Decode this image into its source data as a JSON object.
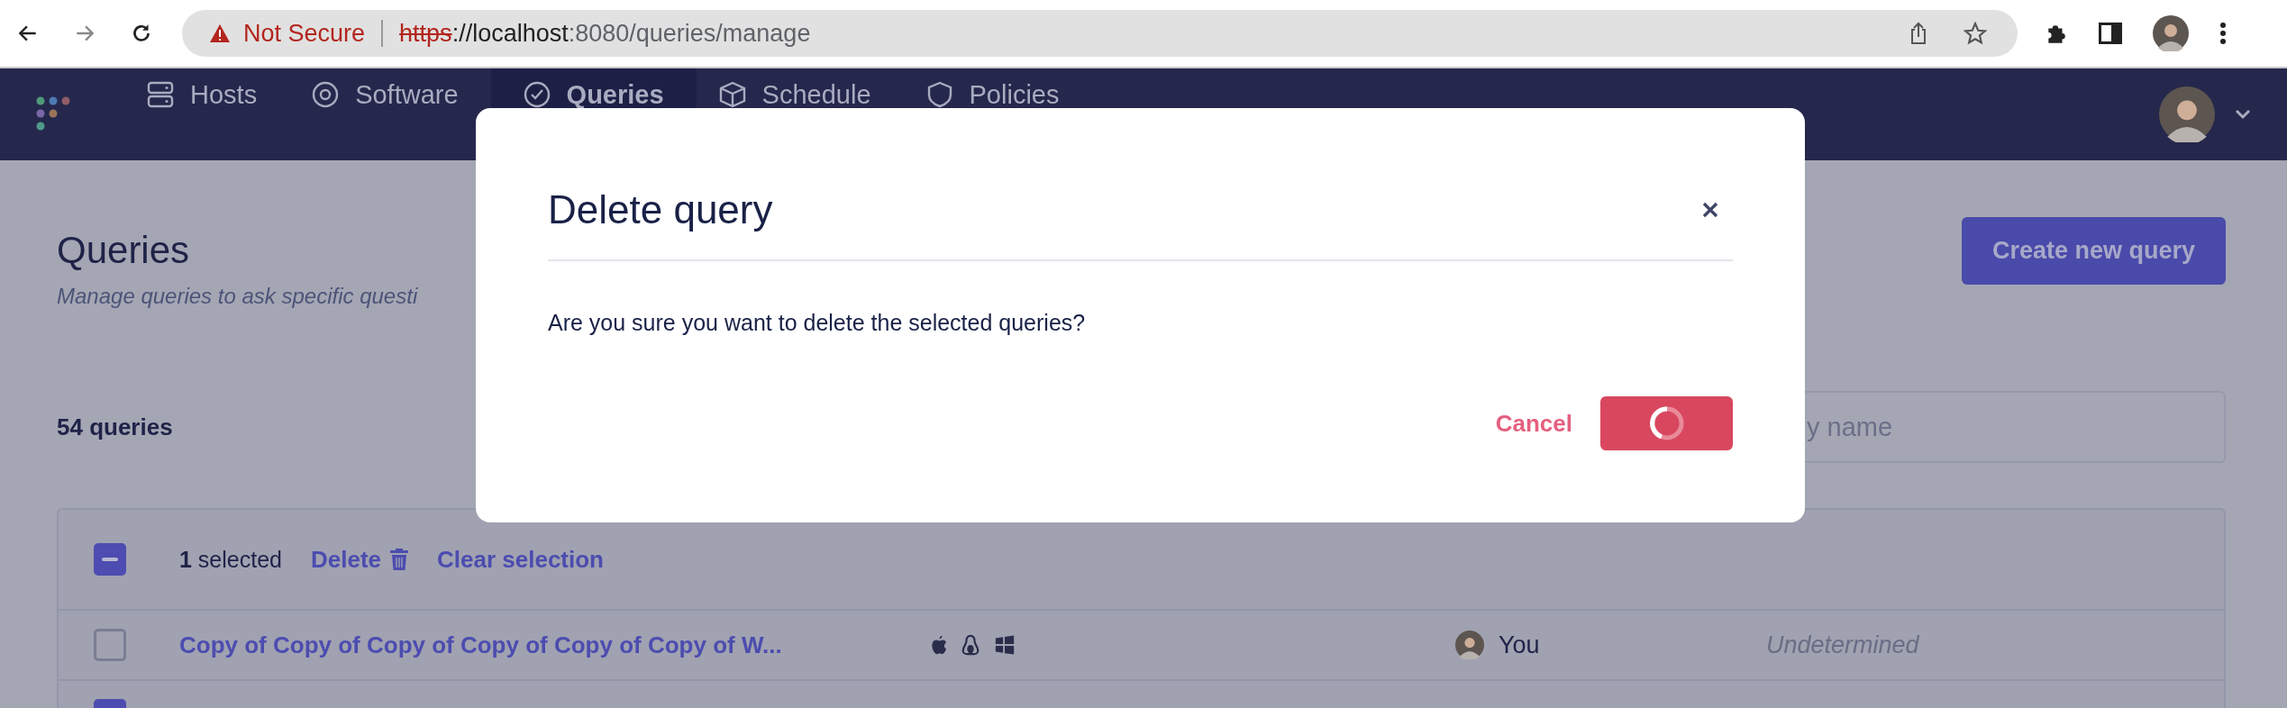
{
  "browser": {
    "warning": "Not Secure",
    "scheme": "https",
    "host": "://localhost",
    "path": ":8080/queries/manage"
  },
  "nav": {
    "items": [
      {
        "label": "Hosts",
        "selected": false
      },
      {
        "label": "Software",
        "selected": false
      },
      {
        "label": "Queries",
        "selected": true
      },
      {
        "label": "Schedule",
        "selected": false
      },
      {
        "label": "Policies",
        "selected": false
      }
    ]
  },
  "page": {
    "title": "Queries",
    "subtitle": "Manage queries to ask specific questi",
    "create_button": "Create new query",
    "count": "54 queries",
    "search": {
      "placeholder": "y name"
    }
  },
  "table": {
    "header": {
      "indeterminate": true,
      "selected_count": "1",
      "selected_label": "selected",
      "delete_link": "Delete",
      "clear_link": "Clear selection"
    },
    "rows": [
      {
        "checked": false,
        "name": "Copy of Copy of Copy of Copy of Copy of Copy of W...",
        "author": "You",
        "performance": "Undetermined"
      },
      {
        "checked": true
      }
    ]
  },
  "modal": {
    "title": "Delete query",
    "message": "Are you sure you want to delete the selected queries?",
    "cancel": "Cancel",
    "confirm_loading": true
  }
}
